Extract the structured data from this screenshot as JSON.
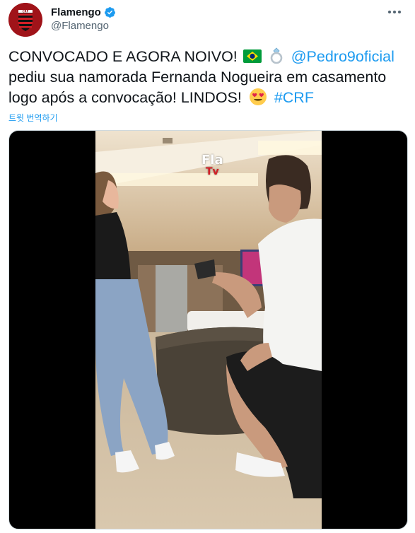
{
  "account": {
    "display_name": "Flamengo",
    "handle": "@Flamengo",
    "avatar_icon": "flamengo-crest-icon",
    "verified_icon": "verified-badge-icon",
    "more_icon": "more-options-icon",
    "brand_color": "#a01319"
  },
  "tweet": {
    "text_part1": "CONVOCADO E AGORA NOIVO!",
    "flag_emoji": "brazil-flag-emoji",
    "ring_emoji": "ring-emoji",
    "mention": "@Pedro9oficial",
    "text_part2": "pediu sua namorada Fernanda Nogueira em casamento logo após a convocação! LINDOS!",
    "heart_eyes_emoji": "heart-eyes-emoji",
    "hashtag": "#CRF",
    "translate_label": "트윗 번역하기",
    "link_color": "#1d9bf0"
  },
  "media": {
    "type": "video",
    "watermark_main": "Fla",
    "watermark_sub": "Tv"
  }
}
